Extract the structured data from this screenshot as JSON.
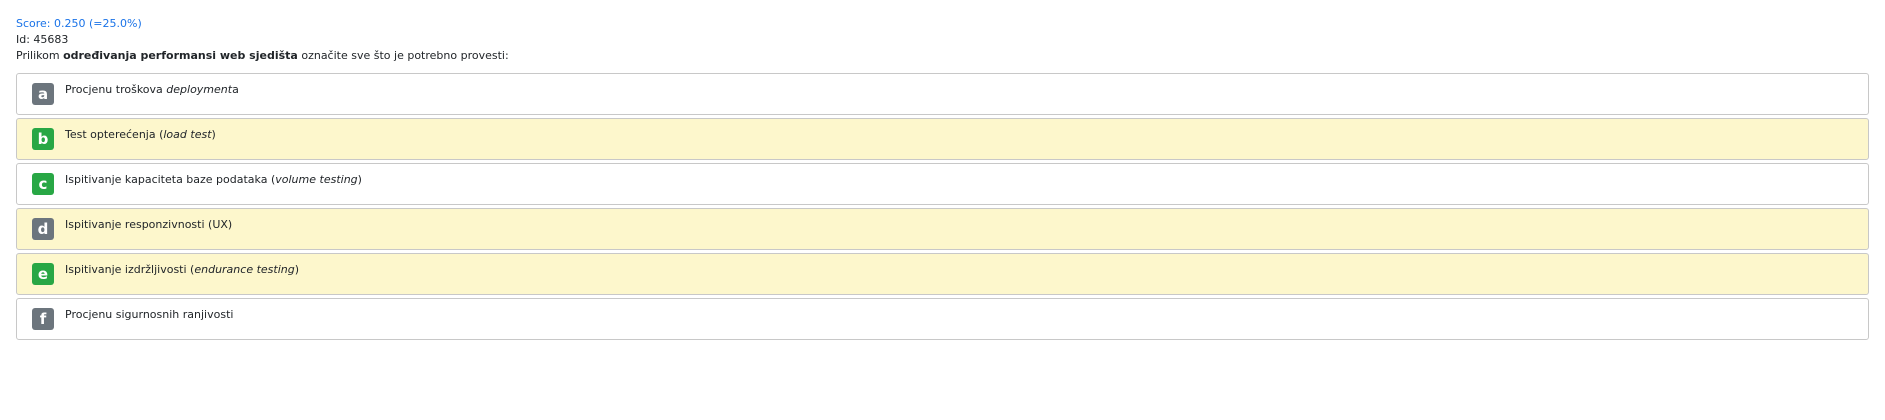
{
  "score": "Score: 0.250 (=25.0%)",
  "id_line": "Id: 45683",
  "question": {
    "prefix": "Prilikom ",
    "bold": "određivanja performansi web sjedišta",
    "suffix": " označite sve što je potrebno provesti:"
  },
  "answers": [
    {
      "letter": "a",
      "text": "Procjenu troškova ",
      "italic": "deployment",
      "after": "a",
      "badge_color": "#6c757d",
      "highlighted": false
    },
    {
      "letter": "b",
      "text": "Test opterećenja (",
      "italic": "load test",
      "after": ")",
      "badge_color": "#28a745",
      "highlighted": true
    },
    {
      "letter": "c",
      "text": "Ispitivanje kapaciteta baze podataka (",
      "italic": "volume testing",
      "after": ")",
      "badge_color": "#28a745",
      "highlighted": false
    },
    {
      "letter": "d",
      "text": "Ispitivanje responzivnosti (UX)",
      "italic": "",
      "after": "",
      "badge_color": "#6c757d",
      "highlighted": true
    },
    {
      "letter": "e",
      "text": "Ispitivanje izdržljivosti (",
      "italic": "endurance testing",
      "after": ")",
      "badge_color": "#28a745",
      "highlighted": true
    },
    {
      "letter": "f",
      "text": "Procjenu sigurnosnih ranjivosti",
      "italic": "",
      "after": "",
      "badge_color": "#6c757d",
      "highlighted": false
    }
  ],
  "colors": {
    "score": "#1a73e8",
    "highlight_bg": "#fdf7cc",
    "correct_badge": "#28a745",
    "neutral_badge": "#6c757d"
  }
}
